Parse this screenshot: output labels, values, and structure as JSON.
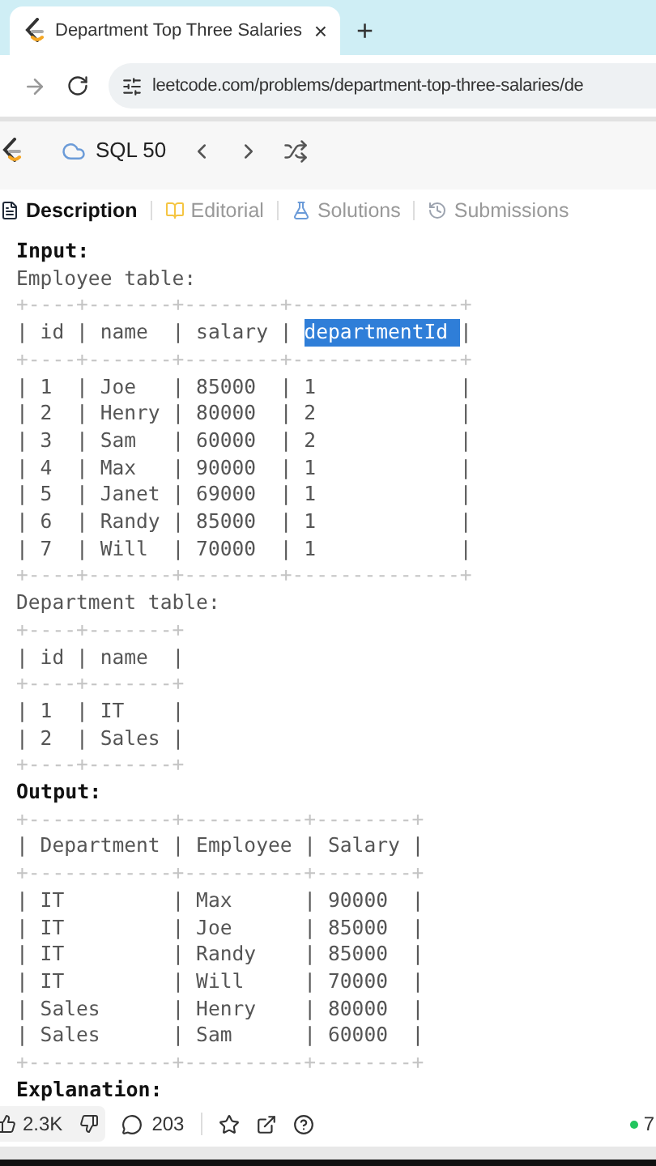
{
  "browser": {
    "tab_title": "Department Top Three Salaries",
    "close": "×",
    "new_tab": "+",
    "url": "leetcode.com/problems/department-top-three-salaries/de"
  },
  "toolbar": {
    "list_name": "SQL 50"
  },
  "tabs": [
    {
      "label": "Description",
      "selected": true
    },
    {
      "label": "Editorial",
      "selected": false
    },
    {
      "label": "Solutions",
      "selected": false
    },
    {
      "label": "Submissions",
      "selected": false
    }
  ],
  "content": [
    {
      "kind": "heading",
      "text": "Input:"
    },
    {
      "kind": "text",
      "text": "Employee table:"
    },
    {
      "kind": "rule",
      "text": "+----+-------+--------+--------------+"
    },
    {
      "kind": "row",
      "segments": [
        {
          "text": "| id | name  | salary | ",
          "selected": false
        },
        {
          "text": "departmentId ",
          "selected": true
        },
        {
          "text": "|",
          "selected": false
        }
      ]
    },
    {
      "kind": "rule",
      "text": "+----+-------+--------+--------------+"
    },
    {
      "kind": "row",
      "text": "| 1  | Joe   | 85000  | 1            |"
    },
    {
      "kind": "row",
      "text": "| 2  | Henry | 80000  | 2            |"
    },
    {
      "kind": "row",
      "text": "| 3  | Sam   | 60000  | 2            |"
    },
    {
      "kind": "row",
      "text": "| 4  | Max   | 90000  | 1            |"
    },
    {
      "kind": "row",
      "text": "| 5  | Janet | 69000  | 1            |"
    },
    {
      "kind": "row",
      "text": "| 6  | Randy | 85000  | 1            |"
    },
    {
      "kind": "row",
      "text": "| 7  | Will  | 70000  | 1            |"
    },
    {
      "kind": "rule",
      "text": "+----+-------+--------+--------------+"
    },
    {
      "kind": "text",
      "text": "Department table:"
    },
    {
      "kind": "rule",
      "text": "+----+-------+"
    },
    {
      "kind": "row",
      "text": "| id | name  |"
    },
    {
      "kind": "rule",
      "text": "+----+-------+"
    },
    {
      "kind": "row",
      "text": "| 1  | IT    |"
    },
    {
      "kind": "row",
      "text": "| 2  | Sales |"
    },
    {
      "kind": "rule",
      "text": "+----+-------+"
    },
    {
      "kind": "heading",
      "text": "Output:"
    },
    {
      "kind": "rule",
      "text": "+------------+----------+--------+"
    },
    {
      "kind": "row",
      "text": "| Department | Employee | Salary |"
    },
    {
      "kind": "rule",
      "text": "+------------+----------+--------+"
    },
    {
      "kind": "row",
      "text": "| IT         | Max      | 90000  |"
    },
    {
      "kind": "row",
      "text": "| IT         | Joe      | 85000  |"
    },
    {
      "kind": "row",
      "text": "| IT         | Randy    | 85000  |"
    },
    {
      "kind": "row",
      "text": "| IT         | Will     | 70000  |"
    },
    {
      "kind": "row",
      "text": "| Sales      | Henry    | 80000  |"
    },
    {
      "kind": "row",
      "text": "| Sales      | Sam      | 60000  |"
    },
    {
      "kind": "rule",
      "text": "+------------+----------+--------+"
    },
    {
      "kind": "heading",
      "text": "Explanation:"
    }
  ],
  "footer": {
    "likes": "2.3K",
    "comments": "203",
    "online": "7"
  }
}
